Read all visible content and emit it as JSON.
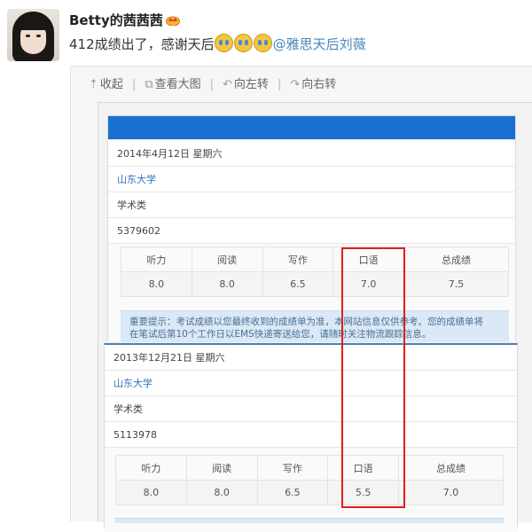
{
  "post": {
    "username": "Betty的茜茜茜",
    "text": "412成绩出了，感谢天后",
    "mention": "@雅思天后刘薇"
  },
  "toolbar": {
    "collapse": "收起",
    "view_large": "查看大图",
    "rotate_left": "向左转",
    "rotate_right": "向右转"
  },
  "results": [
    {
      "date": "2014年4月12日 星期六",
      "center": "山东大学",
      "module": "学术类",
      "candidate_no": "5379602",
      "headers": [
        "听力",
        "阅读",
        "写作",
        "口语",
        "总成绩"
      ],
      "scores": [
        "8.0",
        "8.0",
        "6.5",
        "7.0",
        "7.5"
      ],
      "notice_line1": "重要提示：考试成绩以您最终收到的成绩单为准，本网站信息仅供参考。您的成绩单将",
      "notice_line2": "在笔试后第10个工作日以EMS快递寄送给您，请随时关注物流跟踪信息。"
    },
    {
      "date": "2013年12月21日 星期六",
      "center": "山东大学",
      "module": "学术类",
      "candidate_no": "5113978",
      "headers": [
        "听力",
        "阅读",
        "写作",
        "口语",
        "总成绩"
      ],
      "scores": [
        "8.0",
        "8.0",
        "6.5",
        "5.5",
        "7.0"
      ]
    }
  ],
  "colors": {
    "highlight_box": "#e21c1c",
    "link_blue": "#4a86b8",
    "header_bar": "#1b6fd1"
  }
}
